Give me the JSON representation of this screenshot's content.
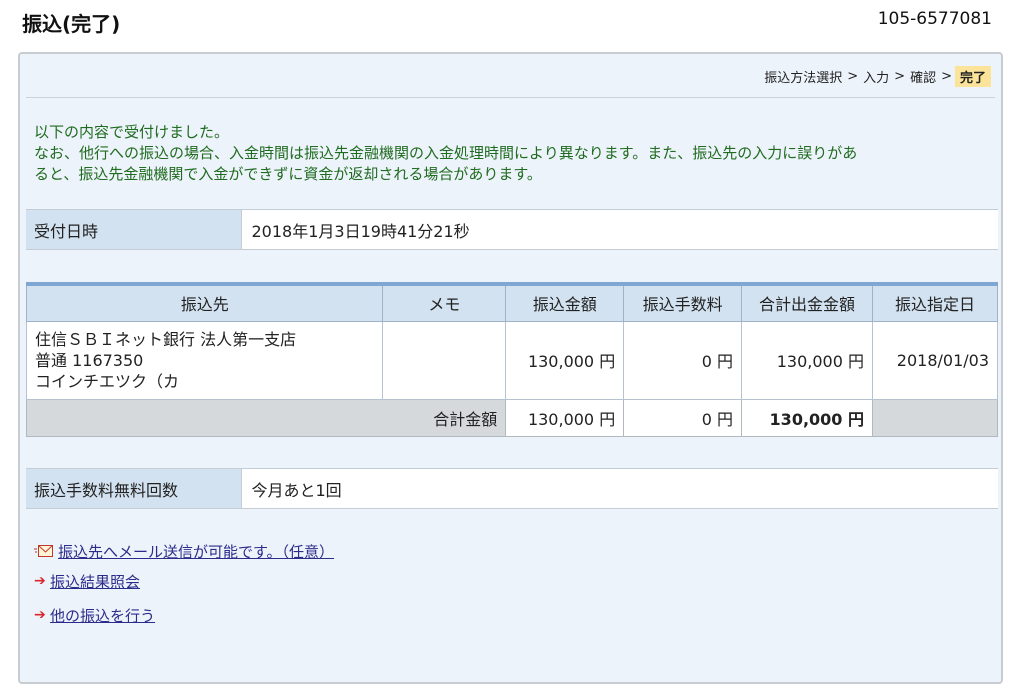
{
  "header": {
    "title": "振込(完了)",
    "account_number": "105-6577081"
  },
  "steps": {
    "items": [
      "振込方法選択",
      "入力",
      "確認",
      "完了"
    ],
    "separator": ">",
    "current_index": 3
  },
  "message": {
    "line1": "以下の内容で受付けました。",
    "line2": "なお、他行への振込の場合、入金時間は振込先金融機関の入金処理時間により異なります。また、振込先の入力に誤りがあ",
    "line3": "ると、振込先金融機関で入金ができずに資金が返却される場合があります。"
  },
  "receipt": {
    "label": "受付日時",
    "value": "2018年1月3日19時41分21秒"
  },
  "transfer_table": {
    "headers": [
      "振込先",
      "メモ",
      "振込金額",
      "振込手数料",
      "合計出金金額",
      "振込指定日"
    ],
    "row": {
      "destination_bank": "住信ＳＢＩネット銀行 法人第一支店",
      "destination_account": "普通 1167350",
      "destination_name": "コインチエツク（カ",
      "memo": "",
      "amount": "130,000 円",
      "fee": "0 円",
      "total": "130,000 円",
      "date": "2018/01/03"
    },
    "totals": {
      "label": "合計金額",
      "amount": "130,000 円",
      "fee": "0 円",
      "total": "130,000 円"
    }
  },
  "free_fee": {
    "label": "振込手数料無料回数",
    "value": "今月あと1回"
  },
  "links": {
    "mail": "振込先へメール送信が可能です。（任意）",
    "result": "振込結果照会",
    "another": "他の振込を行う"
  },
  "colors": {
    "panel_bg": "#edf3fa",
    "header_cell": "#d3e2f0",
    "message_text": "#1f6b1f",
    "current_step": "#fbe49a",
    "link": "#2b2b8c",
    "arrow": "#d9272e"
  }
}
